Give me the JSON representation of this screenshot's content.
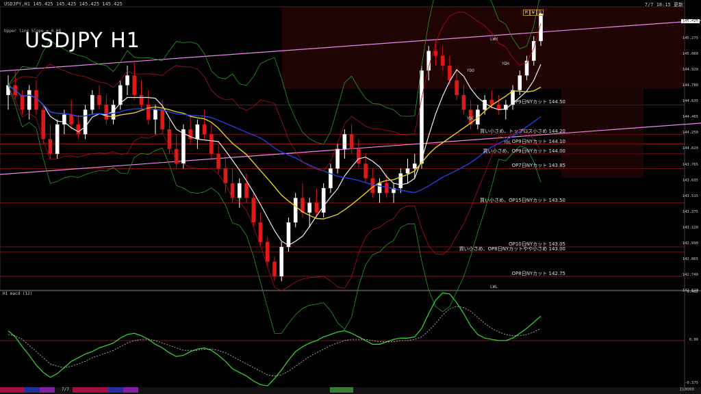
{
  "header": {
    "symbol_line": "USDJPY,H1  145.425 145.425 145.425 145.425",
    "big_title": "USDJPY H1",
    "sub_line": "Upper line Slope = 0.08",
    "clock": "7/7 18:15",
    "clock_suffix": "更新",
    "last_price": "145.425",
    "macd_label": "H1  macd (12)"
  },
  "badges": [
    {
      "text": "M",
      "color": "#d02020"
    },
    {
      "text": "W",
      "color": "#d02020"
    },
    {
      "text": "D",
      "color": "#e0c040"
    }
  ],
  "box_labels": [
    "LWH",
    "YDH",
    "YDO",
    "YDC",
    "YDL",
    "LWL"
  ],
  "price_axis": [
    "145.425",
    "145.275",
    "145.060",
    "144.920",
    "144.780",
    "144.635",
    "144.465",
    "144.250",
    "144.020",
    "143.765",
    "143.635",
    "143.515",
    "143.375",
    "143.120",
    "142.990",
    "142.865",
    "142.740",
    "142.610"
  ],
  "macd_axis": [
    "0.402",
    "0.00",
    "-0.375"
  ],
  "status": {
    "date": "7/7",
    "right": "150000"
  },
  "notes": [
    {
      "text": "OP9日NYカット 144.50",
      "price": 144.5
    },
    {
      "text": "買い小さめ、トップロス小さめ 144.20",
      "price": 144.2
    },
    {
      "text": "OP9日NYカット 144.10",
      "price": 144.1
    },
    {
      "text": "買い小さめ、OP9日NYカット 144.00",
      "price": 144.0
    },
    {
      "text": "OP7日NYカット 143.85",
      "price": 143.85
    },
    {
      "text": "買い小さめ、OP15日NYカット 143.50",
      "price": 143.5
    },
    {
      "text": "OP10日NYカット 143.05",
      "price": 143.05
    },
    {
      "text": "買い小さめ、OP8日NYカットやや小さめ 143.00",
      "price": 143.0
    },
    {
      "text": "OP8日NYカット 142.75",
      "price": 142.75
    }
  ],
  "chart_data": {
    "type": "candlestick",
    "title": "USDJPY H1",
    "ylim": [
      142.61,
      145.5
    ],
    "macd_ylim": [
      -0.375,
      0.402
    ],
    "candles": [
      [
        144.6,
        144.8,
        144.45,
        144.7
      ],
      [
        144.7,
        144.85,
        144.55,
        144.6
      ],
      [
        144.6,
        144.65,
        144.4,
        144.45
      ],
      [
        144.45,
        144.7,
        144.35,
        144.65
      ],
      [
        144.65,
        144.75,
        144.4,
        144.45
      ],
      [
        144.45,
        144.5,
        144.1,
        144.15
      ],
      [
        144.15,
        144.3,
        143.95,
        144.0
      ],
      [
        144.0,
        144.35,
        143.95,
        144.3
      ],
      [
        144.3,
        144.45,
        144.2,
        144.4
      ],
      [
        144.4,
        144.55,
        144.25,
        144.3
      ],
      [
        144.3,
        144.4,
        144.15,
        144.2
      ],
      [
        144.2,
        144.5,
        144.15,
        144.45
      ],
      [
        144.45,
        144.65,
        144.4,
        144.6
      ],
      [
        144.6,
        144.7,
        144.45,
        144.5
      ],
      [
        144.5,
        144.6,
        144.3,
        144.35
      ],
      [
        144.35,
        144.55,
        144.3,
        144.5
      ],
      [
        144.5,
        144.75,
        144.45,
        144.7
      ],
      [
        144.7,
        144.9,
        144.6,
        144.8
      ],
      [
        144.8,
        144.95,
        144.55,
        144.6
      ],
      [
        144.6,
        144.75,
        144.45,
        144.5
      ],
      [
        144.5,
        144.65,
        144.3,
        144.35
      ],
      [
        144.35,
        144.5,
        144.2,
        144.45
      ],
      [
        144.45,
        144.55,
        144.2,
        144.25
      ],
      [
        144.25,
        144.35,
        144.0,
        144.05
      ],
      [
        144.05,
        144.2,
        143.85,
        143.9
      ],
      [
        143.9,
        144.3,
        143.85,
        144.25
      ],
      [
        144.25,
        144.4,
        144.1,
        144.15
      ],
      [
        144.15,
        144.35,
        144.05,
        144.3
      ],
      [
        144.3,
        144.45,
        144.15,
        144.2
      ],
      [
        144.2,
        144.3,
        143.95,
        144.0
      ],
      [
        144.0,
        144.1,
        143.8,
        143.85
      ],
      [
        143.85,
        143.95,
        143.6,
        143.7
      ],
      [
        143.7,
        143.85,
        143.5,
        143.55
      ],
      [
        143.55,
        143.75,
        143.45,
        143.7
      ],
      [
        143.7,
        143.8,
        143.5,
        143.55
      ],
      [
        143.55,
        143.6,
        143.25,
        143.3
      ],
      [
        143.3,
        143.4,
        143.05,
        143.1
      ],
      [
        143.1,
        143.15,
        142.85,
        142.9
      ],
      [
        142.9,
        142.95,
        142.7,
        142.75
      ],
      [
        142.75,
        143.1,
        142.7,
        143.05
      ],
      [
        143.05,
        143.35,
        143.0,
        143.3
      ],
      [
        143.3,
        143.6,
        143.25,
        143.55
      ],
      [
        143.55,
        143.7,
        143.35,
        143.4
      ],
      [
        143.4,
        143.55,
        143.25,
        143.5
      ],
      [
        143.5,
        143.65,
        143.35,
        143.4
      ],
      [
        143.4,
        143.7,
        143.35,
        143.65
      ],
      [
        143.65,
        143.9,
        143.6,
        143.85
      ],
      [
        143.85,
        144.1,
        143.8,
        144.05
      ],
      [
        144.05,
        144.25,
        143.95,
        144.2
      ],
      [
        144.2,
        144.3,
        144.0,
        144.05
      ],
      [
        144.05,
        144.15,
        143.85,
        143.9
      ],
      [
        143.9,
        144.0,
        143.7,
        143.75
      ],
      [
        143.75,
        143.85,
        143.55,
        143.6
      ],
      [
        143.6,
        143.75,
        143.5,
        143.7
      ],
      [
        143.7,
        143.8,
        143.55,
        143.6
      ],
      [
        143.6,
        143.7,
        143.5,
        143.65
      ],
      [
        143.65,
        143.85,
        143.6,
        143.8
      ],
      [
        143.8,
        143.95,
        143.7,
        143.85
      ],
      [
        143.85,
        144.0,
        143.75,
        143.9
      ],
      [
        143.9,
        144.9,
        143.85,
        144.85
      ],
      [
        144.85,
        145.1,
        144.75,
        145.05
      ],
      [
        145.05,
        145.15,
        144.9,
        145.0
      ],
      [
        145.0,
        145.1,
        144.85,
        144.9
      ],
      [
        144.9,
        145.0,
        144.7,
        144.75
      ],
      [
        144.75,
        144.85,
        144.55,
        144.6
      ],
      [
        144.6,
        144.7,
        144.4,
        144.45
      ],
      [
        144.45,
        144.55,
        144.25,
        144.3
      ],
      [
        144.3,
        144.5,
        144.25,
        144.45
      ],
      [
        144.45,
        144.6,
        144.4,
        144.55
      ],
      [
        144.55,
        144.65,
        144.45,
        144.5
      ],
      [
        144.5,
        144.6,
        144.4,
        144.45
      ],
      [
        144.45,
        144.55,
        144.35,
        144.5
      ],
      [
        144.5,
        144.7,
        144.45,
        144.65
      ],
      [
        144.65,
        144.85,
        144.6,
        144.8
      ],
      [
        144.8,
        145.0,
        144.75,
        144.95
      ],
      [
        144.95,
        145.2,
        144.9,
        145.15
      ],
      [
        145.15,
        145.45,
        145.1,
        145.43
      ]
    ],
    "macd": [
      0.08,
      0.03,
      -0.05,
      -0.12,
      -0.2,
      -0.26,
      -0.3,
      -0.27,
      -0.22,
      -0.17,
      -0.14,
      -0.11,
      -0.09,
      -0.06,
      -0.04,
      -0.02,
      0.02,
      0.05,
      0.06,
      0.04,
      0.01,
      -0.03,
      -0.06,
      -0.1,
      -0.13,
      -0.12,
      -0.09,
      -0.07,
      -0.06,
      -0.08,
      -0.12,
      -0.17,
      -0.23,
      -0.26,
      -0.29,
      -0.33,
      -0.36,
      -0.37,
      -0.31,
      -0.24,
      -0.16,
      -0.09,
      -0.05,
      -0.02,
      0.0,
      0.03,
      0.05,
      0.07,
      0.08,
      0.06,
      0.03,
      0.0,
      -0.03,
      -0.03,
      -0.01,
      0.01,
      0.02,
      0.02,
      0.03,
      0.1,
      0.22,
      0.33,
      0.39,
      0.38,
      0.31,
      0.22,
      0.12,
      0.05,
      0.02,
      0.01,
      0.0,
      0.0,
      0.02,
      0.06,
      0.1,
      0.15,
      0.2
    ],
    "signal": [
      0.05,
      0.04,
      0.01,
      -0.04,
      -0.09,
      -0.14,
      -0.19,
      -0.21,
      -0.22,
      -0.21,
      -0.19,
      -0.17,
      -0.14,
      -0.12,
      -0.1,
      -0.08,
      -0.05,
      -0.02,
      0.0,
      0.01,
      0.01,
      0.0,
      -0.02,
      -0.04,
      -0.06,
      -0.08,
      -0.08,
      -0.08,
      -0.07,
      -0.07,
      -0.08,
      -0.1,
      -0.13,
      -0.16,
      -0.19,
      -0.22,
      -0.25,
      -0.28,
      -0.29,
      -0.28,
      -0.25,
      -0.21,
      -0.17,
      -0.13,
      -0.1,
      -0.07,
      -0.04,
      -0.02,
      0.0,
      0.01,
      0.01,
      0.01,
      0.0,
      -0.01,
      -0.01,
      -0.01,
      0.0,
      0.0,
      0.01,
      0.03,
      0.08,
      0.14,
      0.21,
      0.26,
      0.28,
      0.27,
      0.24,
      0.19,
      0.14,
      0.1,
      0.07,
      0.05,
      0.04,
      0.04,
      0.05,
      0.07,
      0.1
    ]
  }
}
